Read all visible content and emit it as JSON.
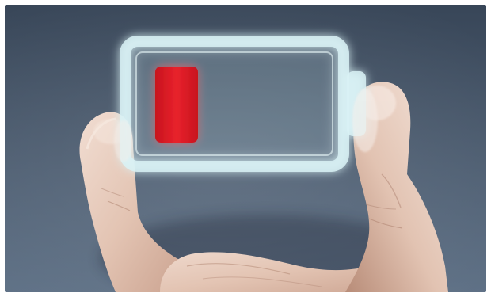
{
  "image": {
    "subject": "hand-holding-low-battery",
    "colors": {
      "background_top": "#384658",
      "background_bottom": "#5f7186",
      "battery_glow": "#d9f2f6",
      "battery_fill": "#e01c26",
      "skin": "#e6cbbd"
    },
    "battery": {
      "charge_level": 0.2,
      "status": "low"
    }
  }
}
